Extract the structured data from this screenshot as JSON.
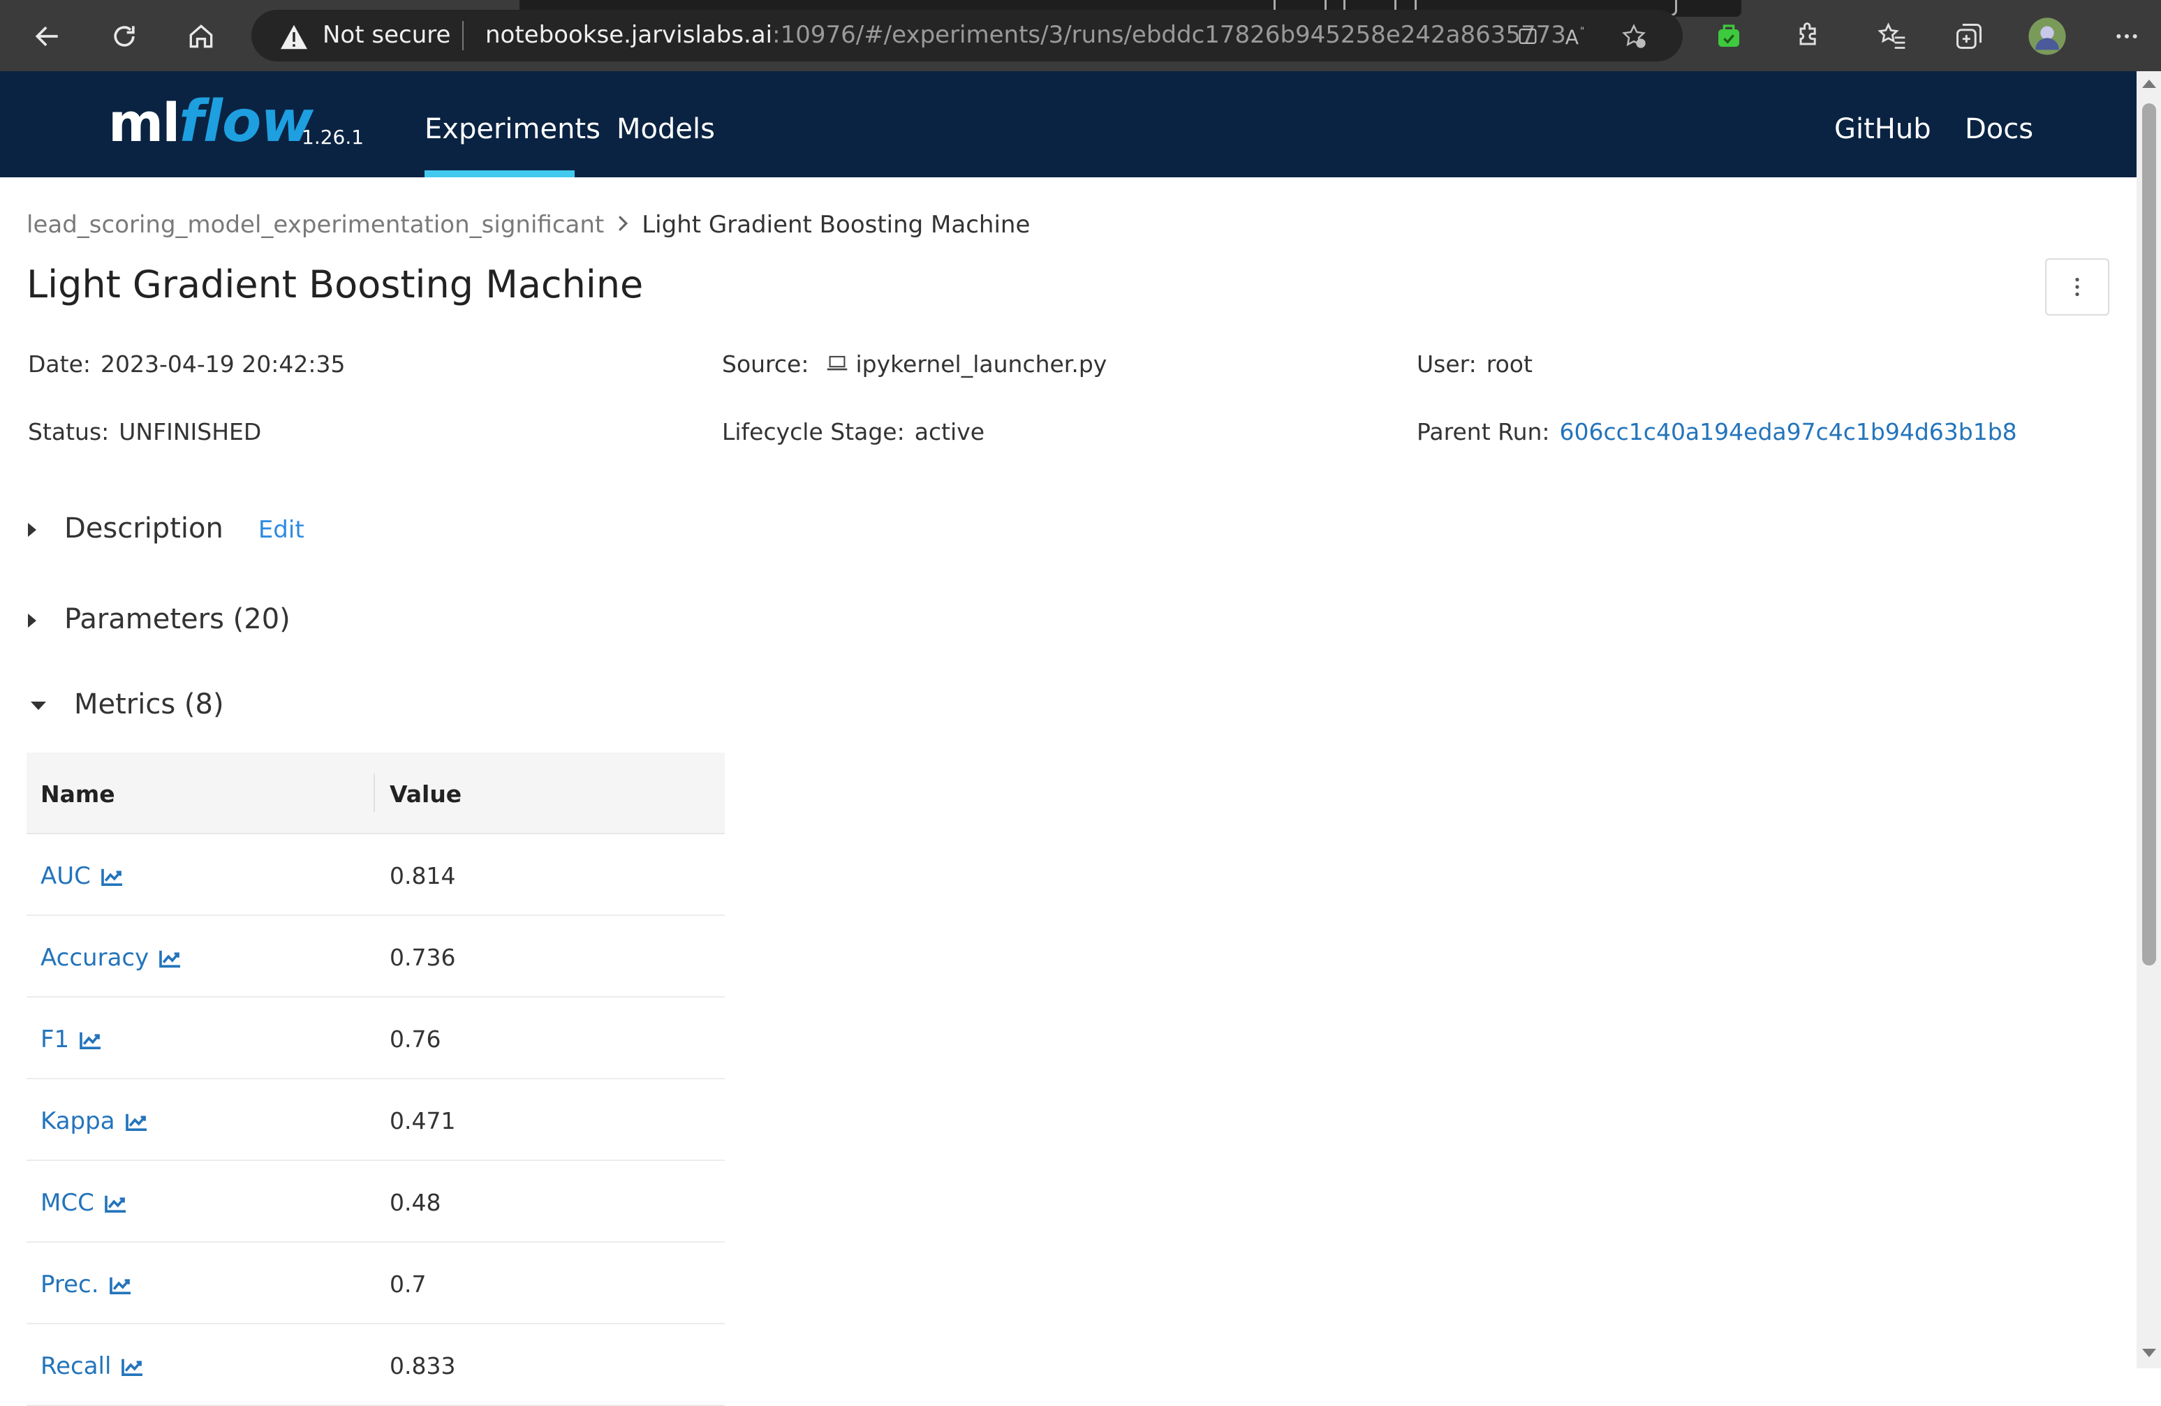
{
  "browser": {
    "not_secure_label": "Not secure",
    "url_host": "notebookse.jarvislabs.ai",
    "url_rest": ":10976/#/experiments/3/runs/ebddc17826b945258e242a86357739...",
    "icons": [
      "back-icon",
      "refresh-icon",
      "home-icon",
      "warning-icon",
      "tab-icon",
      "read-aloud-icon",
      "add-favorite-icon",
      "extension-icon",
      "extensions-icon",
      "favorites-icon",
      "collections-icon",
      "profile-avatar",
      "more-icon"
    ]
  },
  "header": {
    "logo_ml": "ml",
    "logo_flow": "flow",
    "version": "1.26.1",
    "nav": [
      {
        "label": "Experiments",
        "active": true
      },
      {
        "label": "Models",
        "active": false
      }
    ],
    "right_nav": [
      {
        "label": "GitHub"
      },
      {
        "label": "Docs"
      }
    ],
    "colors": {
      "header_bg": "#0a2342",
      "accent": "#43c9ed",
      "link": "#2374bb"
    }
  },
  "breadcrumb": {
    "experiment": "lead_scoring_model_experimentation_significant",
    "current": "Light Gradient Boosting Machine"
  },
  "run": {
    "title": "Light Gradient Boosting Machine",
    "date_label": "Date",
    "date": "2023-04-19 20:42:35",
    "source_label": "Source",
    "source": "ipykernel_launcher.py",
    "user_label": "User",
    "user": "root",
    "status_label": "Status",
    "status": "UNFINISHED",
    "lifecycle_label": "Lifecycle Stage",
    "lifecycle": "active",
    "parent_label": "Parent Run",
    "parent_run": "606cc1c40a194eda97c4c1b94d63b1b8"
  },
  "sections": {
    "description": "Description",
    "edit": "Edit",
    "parameters": "Parameters (20)",
    "metrics": "Metrics (8)"
  },
  "metrics_table": {
    "col_name": "Name",
    "col_value": "Value",
    "rows": [
      {
        "name": "AUC",
        "value": "0.814"
      },
      {
        "name": "Accuracy",
        "value": "0.736"
      },
      {
        "name": "F1",
        "value": "0.76"
      },
      {
        "name": "Kappa",
        "value": "0.471"
      },
      {
        "name": "MCC",
        "value": "0.48"
      },
      {
        "name": "Prec.",
        "value": "0.7"
      },
      {
        "name": "Recall",
        "value": "0.833"
      }
    ]
  }
}
